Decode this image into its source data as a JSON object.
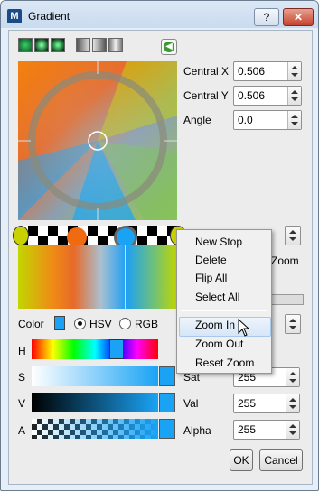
{
  "window": {
    "title": "Gradient",
    "app_icon": "M",
    "help_label": "?",
    "close_label": "✕"
  },
  "presets": [
    {
      "name": "preset-radial-green-1",
      "colors": [
        "#0c5f2a",
        "#36c060"
      ]
    },
    {
      "name": "preset-radial-green-2",
      "colors": [
        "#3fe06c",
        "#08391a"
      ]
    },
    {
      "name": "preset-radial-green-3",
      "colors": [
        "#062d14",
        "#3ad064"
      ]
    },
    {
      "name": "preset-gray-1",
      "colors": [
        "#cfcfcf",
        "#555555"
      ]
    },
    {
      "name": "preset-gray-2",
      "colors": [
        "#5a5a5a",
        "#d0d0d0"
      ]
    },
    {
      "name": "preset-gray-3",
      "colors": [
        "#777777",
        "#e0e0e0"
      ]
    }
  ],
  "add_preset_icon": "arrow-left-icon",
  "fields": {
    "central_x": {
      "label": "Central X",
      "value": "0.506"
    },
    "central_y": {
      "label": "Central Y",
      "value": "0.506"
    },
    "angle": {
      "label": "Angle",
      "value": "0.0"
    }
  },
  "zoom_label": "Zoom",
  "color_row": {
    "label": "Color",
    "hsv_label": "HSV",
    "rgb_label": "RGB",
    "mode": "HSV",
    "color": "#1aa3f5"
  },
  "channels": {
    "h": {
      "label": "H"
    },
    "s": {
      "label": "S",
      "field_label": "Sat",
      "value": "255"
    },
    "v": {
      "label": "V",
      "field_label": "Val",
      "value": "255"
    },
    "a": {
      "label": "A",
      "field_label": "Alpha",
      "value": "255"
    }
  },
  "context_menu": {
    "items": [
      "New Stop",
      "Delete",
      "Flip All",
      "Select All",
      "Zoom In",
      "Zoom Out",
      "Reset Zoom"
    ],
    "hovered": "Zoom In"
  },
  "buttons": {
    "ok": "OK",
    "cancel": "Cancel"
  },
  "colors": {
    "accent": "#1aa3f5",
    "titlebar": "#c9dbef"
  }
}
